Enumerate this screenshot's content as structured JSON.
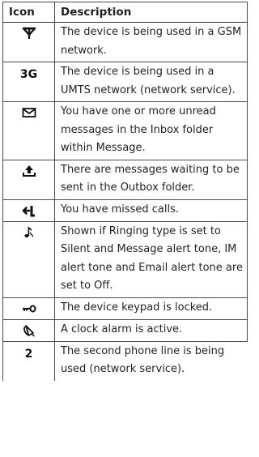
{
  "table": {
    "header": {
      "icon": "Icon",
      "description": "Description"
    },
    "rows": [
      {
        "icon": "gsm-network-icon",
        "icon_text": "",
        "description": "The device is being used in a GSM network."
      },
      {
        "icon": "umts-3g-icon",
        "icon_text": "3G",
        "description": "The device is being used in a UMTS network (network service)."
      },
      {
        "icon": "envelope-icon",
        "icon_text": "",
        "description": "You have one or more unread messages in the Inbox folder within Message."
      },
      {
        "icon": "outbox-upload-icon",
        "icon_text": "",
        "description": "There are messages waiting to be sent in the Outbox folder."
      },
      {
        "icon": "missed-call-icon",
        "icon_text": "",
        "description": "You have missed calls."
      },
      {
        "icon": "silent-note-icon",
        "icon_text": "",
        "description": "Shown if Ringing type is set to Silent and Message alert tone, IM alert tone and Email alert tone are set to Off."
      },
      {
        "icon": "key-lock-icon",
        "icon_text": "",
        "description": "The device keypad is locked."
      },
      {
        "icon": "alarm-clock-icon",
        "icon_text": "",
        "description": "A clock alarm is active."
      },
      {
        "icon": "line-2-icon",
        "icon_text": "2",
        "description": "The second phone line is being used (network service)."
      }
    ]
  }
}
